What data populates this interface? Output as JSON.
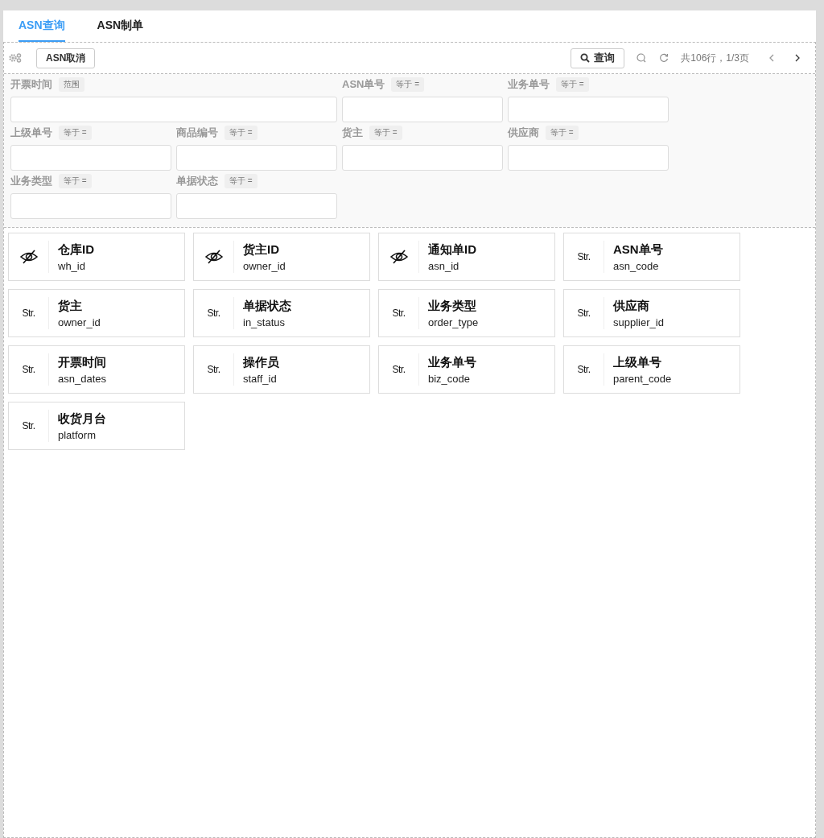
{
  "tabs": [
    {
      "label": "ASN查询",
      "selected": true
    },
    {
      "label": "ASN制单",
      "selected": false
    }
  ],
  "toolbar": {
    "buttons": [
      {
        "label": "ASN取消"
      }
    ],
    "query_button": "查询",
    "page_info": "共106行，1/3页"
  },
  "filter_rows": [
    [
      {
        "kind": "range",
        "label": "开票时间",
        "operator": "范围"
      },
      {
        "kind": "equals",
        "label": "ASN单号",
        "operator": "等于 ="
      },
      {
        "kind": "equals",
        "label": "业务单号",
        "operator": "等于 ="
      }
    ],
    [
      {
        "kind": "equals",
        "label": "上级单号",
        "operator": "等于 ="
      },
      {
        "kind": "equals",
        "label": "商品编号",
        "operator": "等于 ="
      },
      {
        "kind": "equals",
        "label": "货主",
        "operator": "等于 ="
      },
      {
        "kind": "equals",
        "label": "供应商",
        "operator": "等于 ="
      }
    ],
    [
      {
        "kind": "equals",
        "label": "业务类型",
        "operator": "等于 ="
      },
      {
        "kind": "equals",
        "label": "单据状态",
        "operator": "等于 ="
      }
    ]
  ],
  "fields": [
    {
      "kind": "hidden",
      "title": "仓库ID",
      "code": "wh_id"
    },
    {
      "kind": "hidden",
      "title": "货主ID",
      "code": "owner_id"
    },
    {
      "kind": "hidden",
      "title": "通知单ID",
      "code": "asn_id"
    },
    {
      "kind": "string",
      "type_label": "Str.",
      "title": "ASN单号",
      "code": "asn_code"
    },
    {
      "kind": "string",
      "type_label": "Str.",
      "title": "货主",
      "code": "owner_id"
    },
    {
      "kind": "string",
      "type_label": "Str.",
      "title": "单据状态",
      "code": "in_status"
    },
    {
      "kind": "string",
      "type_label": "Str.",
      "title": "业务类型",
      "code": "order_type"
    },
    {
      "kind": "string",
      "type_label": "Str.",
      "title": "供应商",
      "code": "supplier_id"
    },
    {
      "kind": "string",
      "type_label": "Str.",
      "title": "开票时间",
      "code": "asn_dates"
    },
    {
      "kind": "string",
      "type_label": "Str.",
      "title": "操作员",
      "code": "staff_id"
    },
    {
      "kind": "string",
      "type_label": "Str.",
      "title": "业务单号",
      "code": "biz_code"
    },
    {
      "kind": "string",
      "type_label": "Str.",
      "title": "上级单号",
      "code": "parent_code"
    },
    {
      "kind": "string",
      "type_label": "Str.",
      "title": "收货月台",
      "code": "platform"
    }
  ]
}
